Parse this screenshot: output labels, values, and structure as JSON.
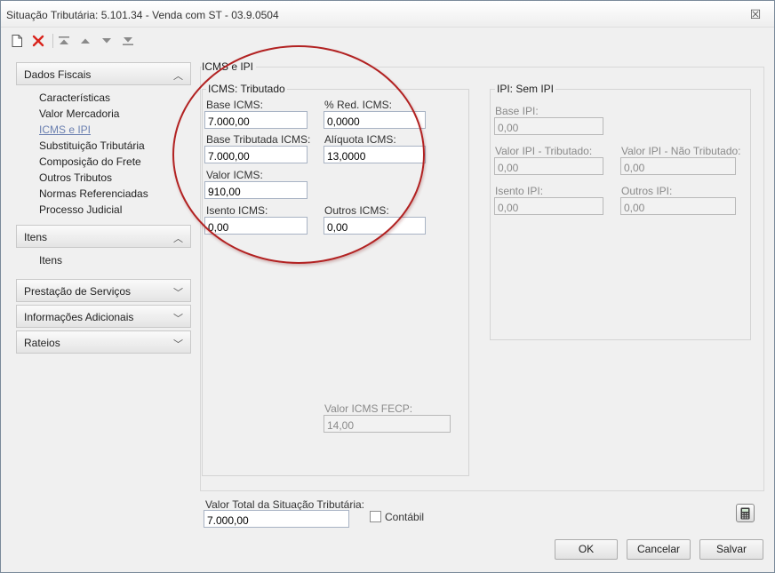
{
  "window": {
    "title": "Situação Tributária: 5.101.34 - Venda com ST - 03.9.0504",
    "close_glyph": "☒"
  },
  "toolbar": {
    "icons": [
      "new-document-icon",
      "delete-icon",
      "move-first-icon",
      "move-up-icon",
      "move-down-icon",
      "move-last-icon"
    ]
  },
  "sidebar": {
    "groups": [
      {
        "label": "Dados Fiscais",
        "expanded": true,
        "items": [
          "Características",
          "Valor Mercadoria",
          "ICMS e IPI",
          "Substituição Tributária",
          "Composição do Frete",
          "Outros Tributos",
          "Normas Referenciadas",
          "Processo Judicial"
        ],
        "selected": "ICMS e IPI"
      },
      {
        "label": "Itens",
        "expanded": true,
        "items": [
          "Itens"
        ]
      },
      {
        "label": "Prestação de Serviços",
        "expanded": false
      },
      {
        "label": "Informações Adicionais",
        "expanded": false
      },
      {
        "label": "Rateios",
        "expanded": false
      }
    ]
  },
  "main": {
    "title": "ICMS e IPI",
    "icms": {
      "legend": "ICMS: Tributado",
      "base_icms": {
        "label": "Base ICMS:",
        "value": "7.000,00"
      },
      "red_icms": {
        "label": "% Red. ICMS:",
        "value": "0,0000"
      },
      "base_tributada": {
        "label": "Base Tributada ICMS:",
        "value": "7.000,00"
      },
      "aliquota": {
        "label": "Alíquota ICMS:",
        "value": "13,0000"
      },
      "valor_icms": {
        "label": "Valor ICMS:",
        "value": "910,00"
      },
      "isento_icms": {
        "label": "Isento ICMS:",
        "value": "0,00"
      },
      "outros_icms": {
        "label": "Outros ICMS:",
        "value": "0,00"
      },
      "valor_fecp": {
        "label": "Valor ICMS FECP:",
        "value": "14,00"
      }
    },
    "ipi": {
      "legend": "IPI: Sem IPI",
      "base_ipi": {
        "label": "Base IPI:",
        "value": "0,00"
      },
      "valor_tributado": {
        "label": "Valor IPI - Tributado:",
        "value": "0,00"
      },
      "valor_nao_tributado": {
        "label": "Valor IPI - Não Tributado:",
        "value": "0,00"
      },
      "isento_ipi": {
        "label": "Isento IPI:",
        "value": "0,00"
      },
      "outros_ipi": {
        "label": "Outros IPI:",
        "value": "0,00"
      }
    }
  },
  "footer": {
    "valor_total": {
      "label": "Valor Total da Situação Tributária:",
      "value": "7.000,00"
    },
    "contabil": {
      "label": "Contábil",
      "checked": false
    },
    "buttons": {
      "ok": "OK",
      "cancel": "Cancelar",
      "save": "Salvar"
    }
  },
  "colors": {
    "annotation_circle": "#b22222",
    "delete_icon": "#d9241c",
    "selected_link": "#6a7fb0"
  }
}
